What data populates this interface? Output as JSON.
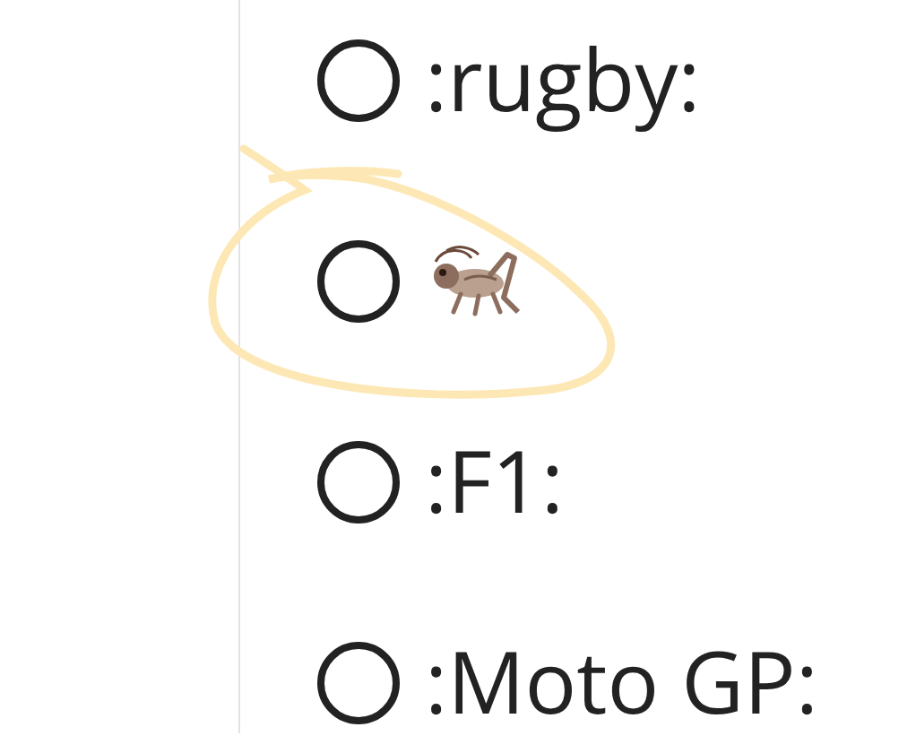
{
  "options": [
    {
      "kind": "text",
      "label": ":rugby:",
      "selected": false
    },
    {
      "kind": "icon",
      "selected": false
    },
    {
      "kind": "text",
      "label": ":F1:",
      "selected": false
    },
    {
      "kind": "text",
      "label": ":Moto GP:",
      "selected": false
    }
  ]
}
